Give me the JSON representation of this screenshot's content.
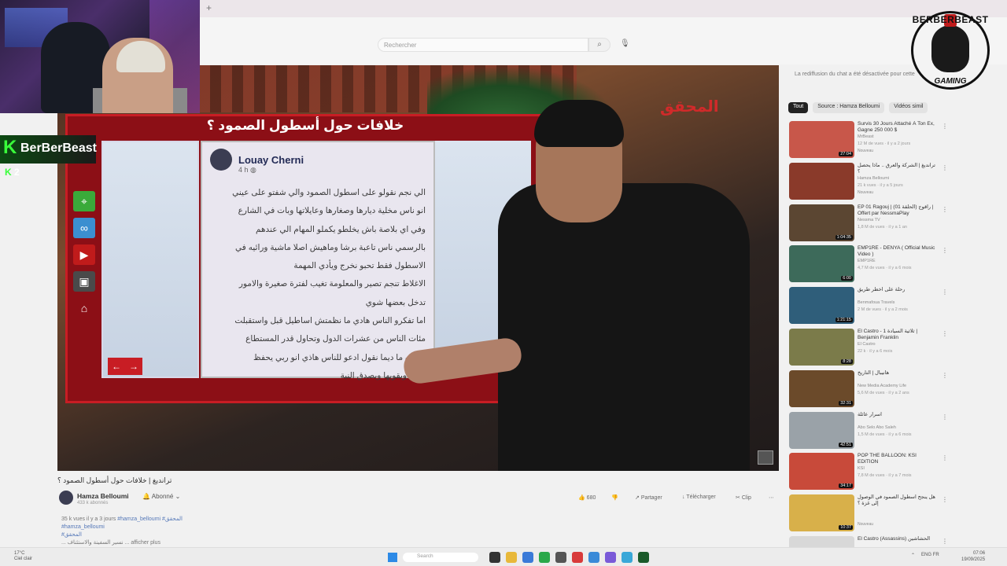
{
  "browser": {
    "new_tab_symbol": "+"
  },
  "youtube": {
    "search_placeholder": "Rechercher",
    "search_icon": "search-icon",
    "mic_icon": "mic-icon"
  },
  "video": {
    "screen_title": "خلافات حول أسطول الصمود ؟",
    "channel_logo": "المحقق",
    "post": {
      "author": "Louay Cherni",
      "time": "4 h",
      "lines": [
        "الي نجم نقولو على اسطول الصمود والي شفتو على عيني",
        "انو ناس مخلية ديارها وصغارها وعايلاتها وبات في الشارع",
        "وفي اي بلاصة باش يخلطو يكملو المهام الي عندهم",
        "بالرسمي ناس تاعبة برشا وماهيش اصلا ماشية ورائيه في",
        "الاسطول فقط تحبو نخرج ويأدي المهمة",
        "الاغلاط تنجم تصير والمعلومة تغيب لفترة صغيرة والامور",
        "تدخل بعضها شوي",
        "اما تفكرو الناس هادي ما نظمتش اساطيل قبل واستقبلت",
        "مئات الناس من عشرات الدول وتحاول قدر المستطاع",
        "الكيف ما ديما نقول ادعو للناس هاذي انو ربي يحفظ",
        "نيتهم ويقويها ويصدق النية"
      ],
      "nav_prev": "←",
      "nav_next": "→"
    }
  },
  "overlay": {
    "k_letter": "K",
    "name": "BerBerBeast",
    "count_k": "K",
    "count": "2"
  },
  "gaming_logo": {
    "top": "BERBERBEAST",
    "bottom": "GAMING"
  },
  "below_video": {
    "title": "ترانديغ | خلافات حول أسطول الصمود ؟",
    "channel": "Hamza Belloumi",
    "subs": "433 k abonnés",
    "subscribe": "Abonné",
    "likes": "680",
    "share": "Partager",
    "download": "Télécharger",
    "clip": "Clip",
    "more": "⋯",
    "desc_stats": "35 k vues  il y a 3 jours",
    "desc_tags": "#hamza_belloumi #المحقق",
    "desc_tag2": "#hamza_belloumi",
    "desc_tag3": "#المحقق",
    "desc_line": "... نسير السفينة والاستئناف ...",
    "show_more": "afficher plus"
  },
  "right_column": {
    "chat_note": "La rediffusion du chat a été désactivée pour cette",
    "chips": [
      "Tout",
      "Source : Hamza Belloumi",
      "Vidéos simil"
    ],
    "recommendations": [
      {
        "title": "Survis 30 Jours Attaché À Ton Ex, Gagne 250 000 $",
        "channel": "MrBeast",
        "views": "12 M de vues · il y a 2 jours",
        "duration": "27:04",
        "badge": "Nouveau",
        "thumb": "#c8574a"
      },
      {
        "title": "ترانديغ | الشركة والعرق .. ماذا يحصل ؟",
        "channel": "Hamza Belloumi",
        "views": "21 k vues · il y a 5 jours",
        "duration": "",
        "badge": "Nouveau",
        "thumb": "#8a3a2a"
      },
      {
        "title": "EP 01 Ragouj | (الحلقة 01) راقوج | Offert par NessmaPlay",
        "channel": "Nessma TV",
        "views": "1,8 M de vues · il y a 1 an",
        "duration": "1:04:35",
        "badge": "",
        "thumb": "#5b4632"
      },
      {
        "title": "EMP1RE - DENYA ( Official Music Video )",
        "channel": "EMP1RE",
        "views": "4,7 M de vues · il y a 6 mois",
        "duration": "6:00",
        "badge": "",
        "thumb": "#3d6a5a"
      },
      {
        "title": "رحلة على أخطر طريق",
        "channel": "Benmafoua Travels",
        "views": "2 M de vues · il y a 2 mois",
        "duration": "1:21:15",
        "badge": "",
        "thumb": "#2f5e7a"
      },
      {
        "title": "El Castro - 1 ثلاثية السيادة | Benjamin Franklin",
        "channel": "El Castro",
        "views": "22 k · il y a 6 mois",
        "duration": "8:28",
        "badge": "",
        "thumb": "#7b7b4a"
      },
      {
        "title": "هانيبال | التاريخ",
        "channel": "New Media Academy Life",
        "views": "5,6 M de vues · il y a 2 ans",
        "duration": "32:31",
        "badge": "",
        "thumb": "#6b4a2a"
      },
      {
        "title": "أسرار عائلة",
        "channel": "Abo Selo Abo Saleh",
        "views": "1,5 M de vues · il y a 6 mois",
        "duration": "42:51",
        "badge": "",
        "thumb": "#9aa2a8"
      },
      {
        "title": "POP THE BALLOON: KSI EDITION",
        "channel": "KSI",
        "views": "7,8 M de vues · il y a 7 mois",
        "duration": "34:17",
        "badge": "",
        "thumb": "#c84a3a"
      },
      {
        "title": "هل ينجح أسطول الصمود في الوصول إلى غزة ؟",
        "channel": "",
        "views": "",
        "duration": "10:37",
        "badge": "Nouveau",
        "thumb": "#d8b04a"
      },
      {
        "title": "El Castro (Assassins) الحشاشين",
        "channel": "El Castro",
        "views": "",
        "duration": "",
        "badge": "",
        "thumb": "#d8d8d8"
      }
    ]
  },
  "taskbar": {
    "weather_temp": "17°C",
    "weather_desc": "Ciel clair",
    "search": "Search",
    "lang": "ENG",
    "lang2": "FR",
    "time": "07:06",
    "date": "19/09/2025"
  }
}
